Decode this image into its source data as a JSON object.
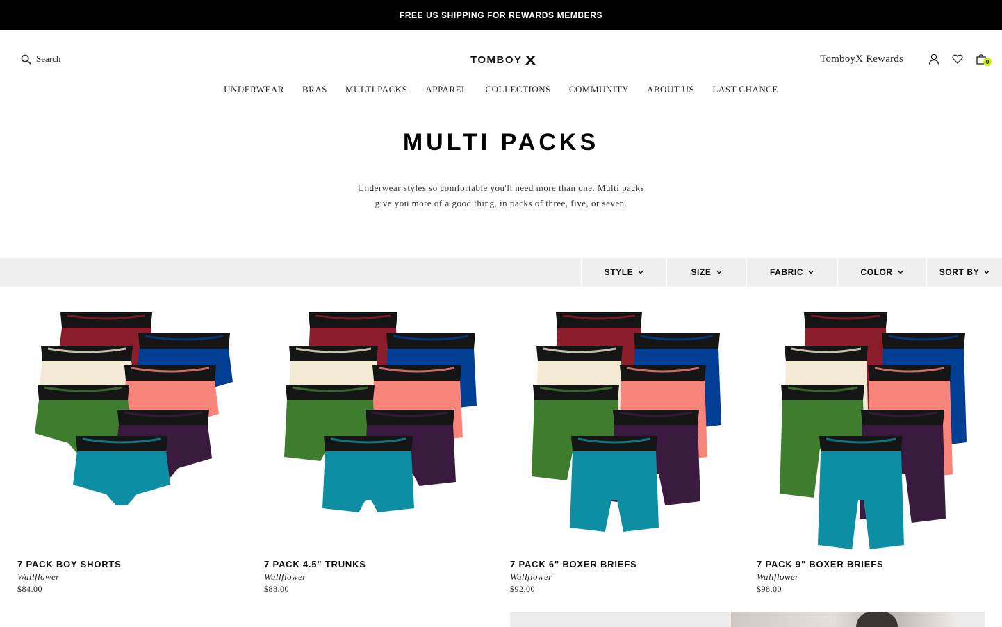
{
  "announcement": {
    "text": "FREE US SHIPPING FOR REWARDS MEMBERS"
  },
  "header": {
    "search_label": "Search",
    "logo_text": "TOMBOY",
    "rewards_link": "TomboyX Rewards",
    "cart_count": "0",
    "icons": [
      "search-icon",
      "account-icon",
      "heart-icon",
      "bag-icon"
    ],
    "accent_color": "#c7f000"
  },
  "nav": {
    "items": [
      "UNDERWEAR",
      "BRAS",
      "MULTI PACKS",
      "APPAREL",
      "COLLECTIONS",
      "COMMUNITY",
      "ABOUT US",
      "LAST CHANCE"
    ]
  },
  "page": {
    "title": "MULTI PACKS",
    "description": "Underwear styles so comfortable you'll need more than one. Multi packs give you more of a good thing, in packs of three, five, or seven."
  },
  "filters": [
    "STYLE",
    "SIZE",
    "FABRIC",
    "COLOR",
    "SORT BY"
  ],
  "products": [
    {
      "title": "7 PACK BOY SHORTS",
      "color": "Wallflower",
      "price": "$84.00"
    },
    {
      "title": "7 PACK 4.5\" TRUNKS",
      "color": "Wallflower",
      "price": "$88.00"
    },
    {
      "title": "7 PACK 6\" BOXER BRIEFS",
      "color": "Wallflower",
      "price": "$92.00"
    },
    {
      "title": "7 PACK 9\" BOXER BRIEFS",
      "color": "Wallflower",
      "price": "$98.00"
    }
  ],
  "swatch_colors": [
    "#8c1d2b",
    "#003f94",
    "#f2ead3",
    "#f7857a",
    "#3f7d2e",
    "#3a1a3e",
    "#0e8ea3"
  ]
}
